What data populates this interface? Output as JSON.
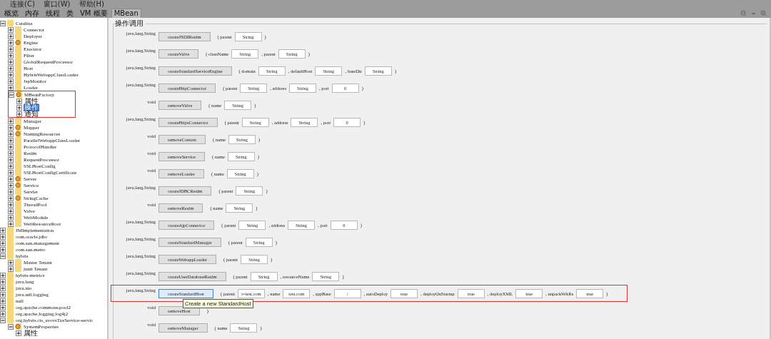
{
  "menu": [
    "连接(C)",
    "窗口(W)",
    "帮助(H)"
  ],
  "tabs": [
    {
      "label": "概览",
      "selected": false
    },
    {
      "label": "内存",
      "selected": false
    },
    {
      "label": "线程",
      "selected": false
    },
    {
      "label": "类",
      "selected": false
    },
    {
      "label": "VM 概要",
      "selected": false
    },
    {
      "label": "MBean",
      "selected": true
    }
  ],
  "tree": [
    {
      "label": "Catalina",
      "kind": "folder",
      "expanded": true,
      "children": [
        {
          "label": "Connector",
          "kind": "folder",
          "expanded": false
        },
        {
          "label": "Deployer",
          "kind": "folder",
          "expanded": false
        },
        {
          "label": "Engine",
          "kind": "bean",
          "expanded": false
        },
        {
          "label": "Executor",
          "kind": "folder",
          "expanded": false
        },
        {
          "label": "Filter",
          "kind": "folder",
          "expanded": false
        },
        {
          "label": "GlobalRequestProcessor",
          "kind": "folder",
          "expanded": false
        },
        {
          "label": "Host",
          "kind": "folder",
          "expanded": false
        },
        {
          "label": "HybrisWebappClassLoader",
          "kind": "folder",
          "expanded": false
        },
        {
          "label": "JspMonitor",
          "kind": "folder",
          "expanded": false
        },
        {
          "label": "Loader",
          "kind": "folder",
          "expanded": false
        },
        {
          "label": "MBeanFactory",
          "kind": "bean",
          "expanded": true,
          "highlighted": true,
          "children": [
            {
              "label": "属性",
              "kind": "leaf",
              "expanded": false,
              "selected": false
            },
            {
              "label": "操作",
              "kind": "leaf",
              "expanded": false,
              "selected": true
            },
            {
              "label": "通知",
              "kind": "leaf",
              "expanded": false,
              "selected": false
            }
          ]
        },
        {
          "label": "Manager",
          "kind": "folder",
          "expanded": false
        },
        {
          "label": "Mapper",
          "kind": "bean",
          "expanded": false
        },
        {
          "label": "NamingResources",
          "kind": "bean",
          "expanded": false
        },
        {
          "label": "ParallelWebappClassLoader",
          "kind": "folder",
          "expanded": false
        },
        {
          "label": "ProtocolHandler",
          "kind": "folder",
          "expanded": false
        },
        {
          "label": "Realm",
          "kind": "folder",
          "expanded": false
        },
        {
          "label": "RequestProcessor",
          "kind": "folder",
          "expanded": false
        },
        {
          "label": "SSLHostConfig",
          "kind": "folder",
          "expanded": false
        },
        {
          "label": "SSLHostConfigCertificate",
          "kind": "folder",
          "expanded": false
        },
        {
          "label": "Server",
          "kind": "bean",
          "expanded": false
        },
        {
          "label": "Service",
          "kind": "bean",
          "expanded": false
        },
        {
          "label": "Servlet",
          "kind": "folder",
          "expanded": false
        },
        {
          "label": "StringCache",
          "kind": "bean",
          "expanded": false
        },
        {
          "label": "ThreadPool",
          "kind": "folder",
          "expanded": false
        },
        {
          "label": "Valve",
          "kind": "folder",
          "expanded": false
        },
        {
          "label": "WebModule",
          "kind": "folder",
          "expanded": false
        },
        {
          "label": "WebResourceRoot",
          "kind": "folder",
          "expanded": false
        }
      ]
    },
    {
      "label": "JMImplementation",
      "kind": "folder",
      "expanded": false
    },
    {
      "label": "com.oracle.jdbc",
      "kind": "folder",
      "expanded": false
    },
    {
      "label": "com.sun.management",
      "kind": "folder",
      "expanded": false
    },
    {
      "label": "com.sun.metro",
      "kind": "folder",
      "expanded": false
    },
    {
      "label": "hybris",
      "kind": "folder",
      "expanded": true,
      "children": [
        {
          "label": "Master Tenant",
          "kind": "folder",
          "expanded": false
        },
        {
          "label": "junit Tenant",
          "kind": "folder",
          "expanded": false
        }
      ]
    },
    {
      "label": "hybris-metrics",
      "kind": "folder",
      "expanded": false
    },
    {
      "label": "java.lang",
      "kind": "folder",
      "expanded": false
    },
    {
      "label": "java.nio",
      "kind": "folder",
      "expanded": false
    },
    {
      "label": "java.util.logging",
      "kind": "folder",
      "expanded": false
    },
    {
      "label": "null",
      "kind": "folder",
      "expanded": false
    },
    {
      "label": "org.apache.commons.pool2",
      "kind": "folder",
      "expanded": false
    },
    {
      "label": "org.apache.logging.log4j2",
      "kind": "folder",
      "expanded": false
    },
    {
      "label": "org.hybris.cis_avovsTaxService-servic",
      "kind": "folder",
      "expanded": true,
      "children": [
        {
          "label": "SystemProperties",
          "kind": "bean",
          "expanded": true,
          "children": [
            {
              "label": "属性",
              "kind": "leaf",
              "expanded": false,
              "selected": false
            }
          ]
        }
      ]
    }
  ],
  "panel_title": "操作调用",
  "operations": [
    {
      "return_type": "java.lang.String",
      "name": "createJNDIRealm",
      "params": [
        {
          "label": "( parent",
          "value": "String"
        }
      ],
      "close": ")"
    },
    {
      "return_type": "java.lang.String",
      "name": "createValve",
      "params": [
        {
          "label": "( className",
          "value": "String"
        },
        {
          "label": ", parent",
          "value": "String"
        }
      ],
      "close": ")"
    },
    {
      "return_type": "java.lang.String",
      "name": "createStandardServiceEngine",
      "params": [
        {
          "label": "( domain",
          "value": "String"
        },
        {
          "label": ", defaultHost",
          "value": "String"
        },
        {
          "label": ", baseDir",
          "value": "String"
        }
      ],
      "close": ")"
    },
    {
      "return_type": "java.lang.String",
      "name": "createHttpConnector",
      "params": [
        {
          "label": "( parent",
          "value": "String"
        },
        {
          "label": ", address",
          "value": "String"
        },
        {
          "label": ", port",
          "value": "0"
        }
      ],
      "close": ")"
    },
    {
      "return_type": "void",
      "name": "removeValve",
      "params": [
        {
          "label": "( name",
          "value": "String"
        }
      ],
      "close": ")"
    },
    {
      "return_type": "java.lang.String",
      "name": "createHttpsConnector",
      "params": [
        {
          "label": "( parent",
          "value": "String"
        },
        {
          "label": ", address",
          "value": "String"
        },
        {
          "label": ", port",
          "value": "0"
        }
      ],
      "close": ")"
    },
    {
      "return_type": "void",
      "name": "removeContext",
      "params": [
        {
          "label": "( name",
          "value": "String"
        }
      ],
      "close": ")"
    },
    {
      "return_type": "void",
      "name": "removeService",
      "params": [
        {
          "label": "( name",
          "value": "String"
        }
      ],
      "close": ")"
    },
    {
      "return_type": "void",
      "name": "removeLoader",
      "params": [
        {
          "label": "( name",
          "value": "String"
        }
      ],
      "close": ")"
    },
    {
      "return_type": "java.lang.String",
      "name": "createJDBCRealm",
      "params": [
        {
          "label": "( parent",
          "value": "String"
        }
      ],
      "close": ")"
    },
    {
      "return_type": "void",
      "name": "removeRealm",
      "params": [
        {
          "label": "( name",
          "value": "String"
        }
      ],
      "close": ")"
    },
    {
      "return_type": "java.lang.String",
      "name": "createAjpConnector",
      "params": [
        {
          "label": "( parent",
          "value": "String"
        },
        {
          "label": ", address",
          "value": "String"
        },
        {
          "label": ", port",
          "value": "0"
        }
      ],
      "close": ")"
    },
    {
      "return_type": "java.lang.String",
      "name": "createStandardManager",
      "params": [
        {
          "label": "( parent",
          "value": "String"
        }
      ],
      "close": ")"
    },
    {
      "return_type": "java.lang.String",
      "name": "createWebappLoader",
      "params": [
        {
          "label": "( parent",
          "value": "String"
        }
      ],
      "close": ")"
    },
    {
      "return_type": "java.lang.String",
      "name": "createUserDatabaseRealm",
      "params": [
        {
          "label": "( parent",
          "value": "String"
        },
        {
          "label": ", resourceName",
          "value": "String"
        }
      ],
      "close": ")"
    },
    {
      "return_type": "java.lang.String",
      "name": "createStandardHost",
      "highlighted": true,
      "selected": true,
      "tooltip": "Create a new StandardHost",
      "params": [
        {
          "label": "( parent",
          "value": "t=test.com"
        },
        {
          "label": ", name",
          "value": "test.com"
        },
        {
          "label": ", appBase",
          "value": "/"
        },
        {
          "label": ", autoDeploy",
          "value": "true"
        },
        {
          "label": ", deployOnStartup",
          "value": "true"
        },
        {
          "label": ", deployXML",
          "value": "true"
        },
        {
          "label": ", unpackWARs",
          "value": "true"
        }
      ],
      "close": ")"
    },
    {
      "return_type": "void",
      "name": "removeHost",
      "close": ")"
    },
    {
      "return_type": "void",
      "name": "removeManager",
      "params": [
        {
          "label": "( name",
          "value": "String"
        }
      ],
      "close": ")"
    }
  ]
}
